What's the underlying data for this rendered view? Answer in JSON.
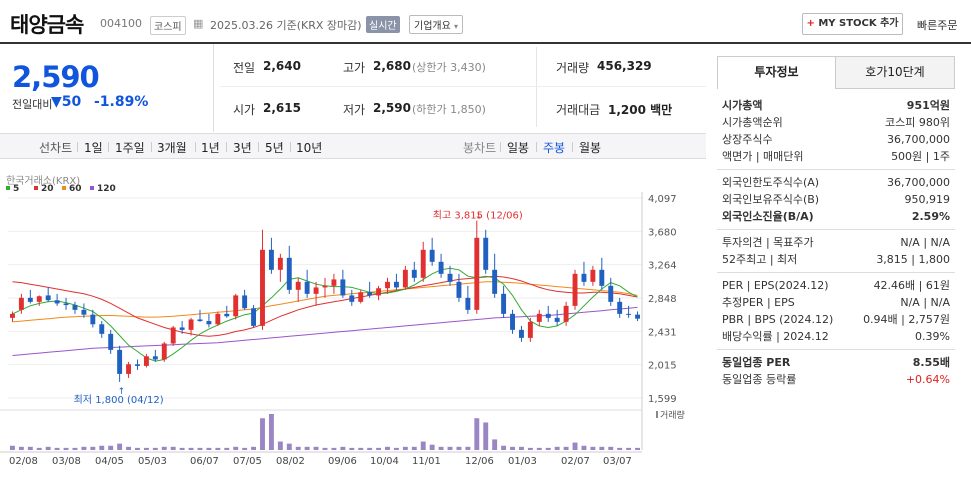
{
  "header": {
    "name": "태양금속",
    "code": "004100",
    "market": "코스피",
    "date": "2025.03.26",
    "basis": "기준(KRX 장마감)",
    "realtime": "실시간",
    "company": "기업개요",
    "mystock": "MY STOCK 추가",
    "quick": "빠른주문"
  },
  "price": {
    "current": "2,590",
    "change_label": "전일대비",
    "change": "50",
    "rate": "-1.89%"
  },
  "quote": {
    "prev_label": "전일",
    "prev": "2,640",
    "high_label": "고가",
    "high": "2,680",
    "upper": "(상한가 3,430)",
    "volume_label": "거래량",
    "volume": "456,329",
    "open_label": "시가",
    "open": "2,615",
    "low_label": "저가",
    "low": "2,590",
    "lower": "(하한가 1,850)",
    "amount_label": "거래대금",
    "amount": "1,200 백만"
  },
  "nav": {
    "select": "선차트",
    "periods": [
      "1일",
      "1주일",
      "3개월",
      "1년",
      "3년",
      "5년",
      "10년"
    ],
    "candle": "봉차트",
    "types": [
      "일봉",
      "주봉",
      "월봉"
    ],
    "active_type": "주봉"
  },
  "chart_data": {
    "type": "candlestick",
    "source": "한국거래소(KRX)",
    "ma_legend": [
      {
        "name": "5",
        "color": "#33aa33"
      },
      {
        "name": "20",
        "color": "#e03030"
      },
      {
        "name": "60",
        "color": "#f08a1a"
      },
      {
        "name": "120",
        "color": "#9955cc"
      }
    ],
    "y_ticks": [
      "4,097",
      "3,680",
      "3,264",
      "2,848",
      "2,431",
      "2,015",
      "1,599"
    ],
    "ylim": [
      1599,
      4097
    ],
    "x_labels": [
      "02/08",
      "03/08",
      "04/05",
      "05/03",
      "06/07",
      "07/05",
      "08/02",
      "09/06",
      "10/04",
      "11/01",
      "12/06",
      "01/03",
      "02/07",
      "03/07"
    ],
    "high_note": "최고 3,815 (12/06)",
    "low_note": "최저 1,800 (04/12)",
    "volume_label": "거래량",
    "candles": [
      [
        2600,
        2680,
        2550,
        2650
      ],
      [
        2700,
        2900,
        2650,
        2850
      ],
      [
        2850,
        2950,
        2780,
        2800
      ],
      [
        2800,
        2880,
        2750,
        2870
      ],
      [
        2880,
        2980,
        2800,
        2820
      ],
      [
        2820,
        2900,
        2750,
        2780
      ],
      [
        2780,
        2850,
        2700,
        2760
      ],
      [
        2760,
        2800,
        2650,
        2700
      ],
      [
        2700,
        2780,
        2600,
        2640
      ],
      [
        2640,
        2700,
        2480,
        2520
      ],
      [
        2520,
        2560,
        2350,
        2400
      ],
      [
        2400,
        2450,
        2150,
        2200
      ],
      [
        2200,
        2250,
        1800,
        1900
      ],
      [
        1900,
        2050,
        1850,
        2020
      ],
      [
        2020,
        2080,
        1950,
        2000
      ],
      [
        2000,
        2150,
        1980,
        2120
      ],
      [
        2120,
        2200,
        2050,
        2080
      ],
      [
        2080,
        2300,
        2050,
        2280
      ],
      [
        2280,
        2500,
        2250,
        2480
      ],
      [
        2480,
        2560,
        2400,
        2450
      ],
      [
        2450,
        2600,
        2380,
        2580
      ],
      [
        2580,
        2700,
        2550,
        2560
      ],
      [
        2560,
        2650,
        2480,
        2520
      ],
      [
        2520,
        2680,
        2500,
        2650
      ],
      [
        2650,
        2750,
        2600,
        2620
      ],
      [
        2620,
        2900,
        2580,
        2880
      ],
      [
        2880,
        2950,
        2700,
        2720
      ],
      [
        2720,
        2760,
        2480,
        2500
      ],
      [
        2500,
        3700,
        2450,
        3450
      ],
      [
        3450,
        3600,
        3150,
        3200
      ],
      [
        3200,
        3400,
        3050,
        3350
      ],
      [
        3350,
        3500,
        2900,
        2950
      ],
      [
        2950,
        3100,
        2800,
        3050
      ],
      [
        3050,
        3200,
        2850,
        2900
      ],
      [
        2900,
        3050,
        2750,
        2980
      ],
      [
        2980,
        3100,
        2850,
        3000
      ],
      [
        3000,
        3150,
        2900,
        3080
      ],
      [
        3080,
        3200,
        2850,
        2880
      ],
      [
        2880,
        2950,
        2750,
        2800
      ],
      [
        2800,
        2950,
        2780,
        2920
      ],
      [
        2920,
        3050,
        2850,
        2880
      ],
      [
        2880,
        3000,
        2820,
        2970
      ],
      [
        2970,
        3100,
        2900,
        3050
      ],
      [
        3050,
        3150,
        2950,
        2980
      ],
      [
        2980,
        3250,
        2950,
        3200
      ],
      [
        3200,
        3300,
        3050,
        3100
      ],
      [
        3100,
        3550,
        3050,
        3450
      ],
      [
        3450,
        3600,
        3250,
        3300
      ],
      [
        3300,
        3400,
        3100,
        3150
      ],
      [
        3150,
        3250,
        3000,
        3050
      ],
      [
        3050,
        3150,
        2800,
        2850
      ],
      [
        2850,
        3000,
        2650,
        2700
      ],
      [
        2700,
        3815,
        2650,
        3600
      ],
      [
        3600,
        3700,
        3150,
        3200
      ],
      [
        3200,
        3400,
        2850,
        2900
      ],
      [
        2900,
        3000,
        2600,
        2650
      ],
      [
        2650,
        2700,
        2400,
        2450
      ],
      [
        2450,
        2500,
        2300,
        2350
      ],
      [
        2350,
        2600,
        2300,
        2550
      ],
      [
        2550,
        2700,
        2500,
        2650
      ],
      [
        2650,
        2750,
        2550,
        2600
      ],
      [
        2600,
        2700,
        2500,
        2550
      ],
      [
        2550,
        2800,
        2500,
        2750
      ],
      [
        2750,
        3200,
        2700,
        3150
      ],
      [
        3150,
        3300,
        3000,
        3050
      ],
      [
        3050,
        3250,
        3000,
        3200
      ],
      [
        3200,
        3350,
        2950,
        3000
      ],
      [
        3000,
        3100,
        2750,
        2800
      ],
      [
        2800,
        2850,
        2600,
        2650
      ],
      [
        2650,
        2750,
        2600,
        2640
      ],
      [
        2640,
        2680,
        2560,
        2590
      ]
    ],
    "volumes": [
      4,
      3,
      3,
      2,
      3,
      2,
      2,
      2,
      3,
      3,
      4,
      4,
      6,
      3,
      2,
      2,
      2,
      3,
      3,
      2,
      2,
      2,
      2,
      2,
      2,
      3,
      2,
      3,
      30,
      34,
      8,
      6,
      3,
      3,
      3,
      2,
      2,
      3,
      2,
      2,
      2,
      2,
      3,
      2,
      3,
      3,
      8,
      5,
      3,
      3,
      3,
      3,
      30,
      26,
      10,
      4,
      3,
      3,
      2,
      2,
      2,
      3,
      3,
      7,
      4,
      3,
      3,
      3,
      2,
      2,
      2
    ],
    "ma5": [
      2650,
      2700,
      2750,
      2780,
      2800,
      2810,
      2790,
      2760,
      2720,
      2680,
      2600,
      2500,
      2380,
      2260,
      2180,
      2100,
      2060,
      2080,
      2150,
      2230,
      2320,
      2400,
      2460,
      2510,
      2560,
      2600,
      2640,
      2660,
      2750,
      2850,
      2960,
      3080,
      3100,
      3060,
      3020,
      3000,
      2990,
      2990,
      2980,
      2950,
      2920,
      2900,
      2910,
      2930,
      2960,
      3010,
      3080,
      3150,
      3200,
      3220,
      3200,
      3120,
      3100,
      3120,
      3100,
      3020,
      2880,
      2700,
      2560,
      2500,
      2480,
      2500,
      2560,
      2640,
      2750,
      2860,
      2960,
      3040,
      3000,
      2920,
      2860
    ],
    "ma20": [
      3050,
      3040,
      3020,
      3000,
      2980,
      2960,
      2940,
      2920,
      2900,
      2870,
      2830,
      2780,
      2720,
      2660,
      2600,
      2560,
      2520,
      2480,
      2450,
      2420,
      2400,
      2380,
      2370,
      2380,
      2400,
      2430,
      2450,
      2480,
      2520,
      2570,
      2620,
      2660,
      2700,
      2730,
      2760,
      2780,
      2800,
      2820,
      2840,
      2860,
      2880,
      2900,
      2920,
      2940,
      2960,
      2980,
      3000,
      3020,
      3040,
      3060,
      3080,
      3090,
      3100,
      3110,
      3120,
      3110,
      3090,
      3060,
      3020,
      2980,
      2950,
      2930,
      2920,
      2910,
      2910,
      2920,
      2920,
      2910,
      2900,
      2880,
      2860
    ],
    "ma60": [
      2550,
      2560,
      2570,
      2580,
      2590,
      2600,
      2610,
      2615,
      2620,
      2625,
      2630,
      2630,
      2625,
      2620,
      2615,
      2610,
      2610,
      2615,
      2620,
      2630,
      2640,
      2650,
      2660,
      2670,
      2680,
      2690,
      2700,
      2710,
      2730,
      2750,
      2770,
      2790,
      2810,
      2830,
      2850,
      2870,
      2880,
      2890,
      2900,
      2910,
      2920,
      2930,
      2940,
      2950,
      2960,
      2970,
      2980,
      2990,
      3000,
      3010,
      3020,
      3030,
      3040,
      3050,
      3050,
      3045,
      3040,
      3030,
      3020,
      3010,
      3000,
      2990,
      2980,
      2970,
      2960,
      2950,
      2940,
      2930,
      2920,
      2900,
      2880
    ],
    "ma120": [
      2130,
      2140,
      2150,
      2160,
      2170,
      2180,
      2190,
      2200,
      2210,
      2220,
      2225,
      2230,
      2235,
      2240,
      2245,
      2250,
      2255,
      2260,
      2265,
      2270,
      2275,
      2280,
      2285,
      2290,
      2300,
      2310,
      2320,
      2330,
      2340,
      2350,
      2360,
      2370,
      2380,
      2390,
      2400,
      2410,
      2420,
      2430,
      2440,
      2450,
      2460,
      2470,
      2480,
      2490,
      2500,
      2510,
      2520,
      2530,
      2540,
      2550,
      2560,
      2570,
      2580,
      2590,
      2600,
      2605,
      2610,
      2615,
      2620,
      2625,
      2630,
      2640,
      2650,
      2660,
      2670,
      2680,
      2690,
      2700,
      2710,
      2720,
      2730
    ]
  },
  "side": {
    "tab1": "투자정보",
    "tab2": "호가10단계",
    "rows1": [
      [
        "시가총액",
        "951억원"
      ],
      [
        "시가총액순위",
        "코스피 980위"
      ],
      [
        "상장주식수",
        "36,700,000"
      ],
      [
        "액면가 | 매매단위",
        "500원 | 1주"
      ]
    ],
    "rows2": [
      [
        "외국인한도주식수(A)",
        "36,700,000"
      ],
      [
        "외국인보유주식수(B)",
        "950,919"
      ],
      [
        "외국인소진율(B/A)",
        "2.59%"
      ]
    ],
    "rows3": [
      [
        "투자의견 | 목표주가",
        "N/A | N/A"
      ],
      [
        "52주최고 | 최저",
        "3,815 | 1,800"
      ]
    ],
    "rows4": [
      [
        "PER | EPS(2024.12)",
        "42.46배 | 61원"
      ],
      [
        "추정PER | EPS",
        "N/A | N/A"
      ],
      [
        "PBR | BPS (2024.12)",
        "0.94배 | 2,757원"
      ],
      [
        "배당수익률 | 2024.12",
        "0.39%"
      ]
    ],
    "rows5": [
      [
        "동일업종 PER",
        "8.55배"
      ],
      [
        "동일업종 등락률",
        "+0.64%"
      ]
    ]
  }
}
